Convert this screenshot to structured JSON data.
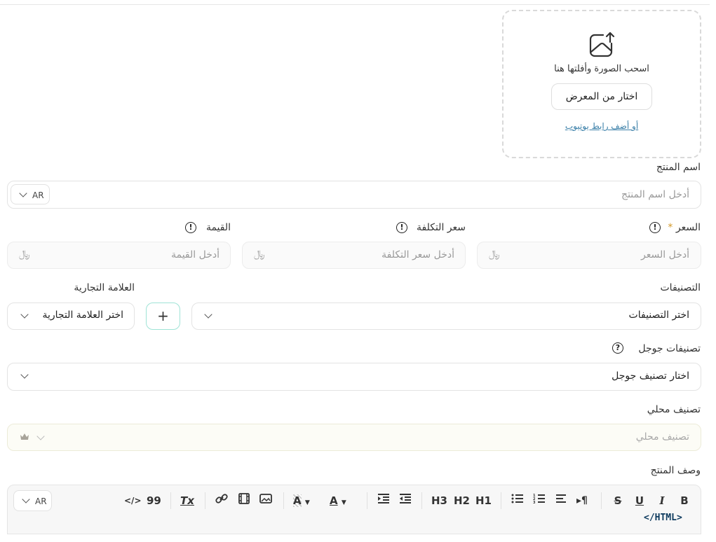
{
  "upload": {
    "drag_text": "اسحب الصورة وأفلتها هنا",
    "gallery_button": "اختار من المعرض",
    "youtube_link": "أو أضف رابط يوتيوب"
  },
  "product_name": {
    "label": "اسم المنتج",
    "placeholder": "أدخل اسم المنتج",
    "lang": "AR"
  },
  "price": {
    "label": "السعر",
    "required_mark": "*",
    "placeholder": "أدخل السعر",
    "info": "!"
  },
  "cost_price": {
    "label": "سعر التكلفة",
    "placeholder": "أدخل سعر التكلفة",
    "info": "!"
  },
  "value": {
    "label": "القيمة",
    "placeholder": "أدخل القيمة",
    "info": "!"
  },
  "currency_symbol": "﷼",
  "categories": {
    "label": "التصنيفات",
    "selected": "اختر التصنيفات"
  },
  "add_button": "+",
  "brand": {
    "label": "العلامة التجارية",
    "selected": "اختر العلامة التجارية"
  },
  "google_categories": {
    "label": "تصنيفات جوجل",
    "help": "?",
    "selected": "اختار تصنيف جوجل"
  },
  "local_category": {
    "label": "تصنيف محلي",
    "placeholder": "تصنيف محلي"
  },
  "description": {
    "label": "وصف المنتج",
    "lang": "AR",
    "html_toggle": "</HTML>",
    "toolbar": {
      "bold": "B",
      "italic": "I",
      "underline": "U",
      "strike": "S",
      "paragraph": "¶",
      "h1": "H1",
      "h2": "H2",
      "h3": "H3",
      "font_color": "A",
      "highlight": "A",
      "clear_format": "Tx",
      "quote": "99",
      "code": "</>"
    }
  },
  "colors": {
    "accent_border": "#9fe3d6",
    "link": "#3a7fa8",
    "required": "#d49a2a"
  }
}
